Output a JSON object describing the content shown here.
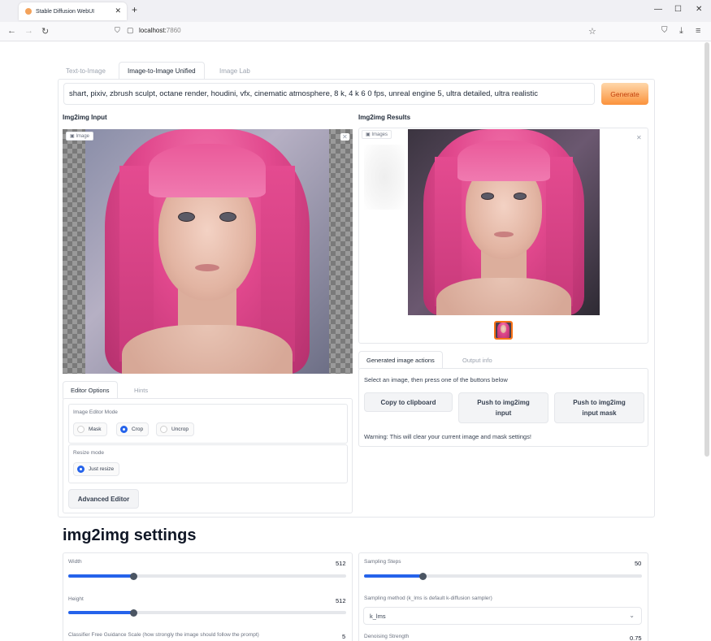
{
  "browser": {
    "tab_title": "Stable Diffusion WebUI",
    "url_host": "localhost:",
    "url_port": "7860"
  },
  "app": {
    "tabs": [
      "Text-to-Image",
      "Image-to-Image Unified",
      "Image Lab"
    ],
    "prompt": "shart, pixiv, zbrush sculpt, octane render, houdini, vfx, cinematic atmosphere, 8 k, 4 k 6 0 fps, unreal engine 5, ultra detailed, ultra realistic",
    "generate_label": "Generate"
  },
  "input": {
    "title": "Img2img Input",
    "image_tag": "Image",
    "tabs": [
      "Editor Options",
      "Hints"
    ],
    "editor_mode_label": "Image Editor Mode",
    "modes": [
      "Mask",
      "Crop",
      "Uncrop"
    ],
    "resize_label": "Resize mode",
    "resize_option": "Just resize",
    "advanced_editor": "Advanced Editor"
  },
  "results": {
    "title": "Img2img Results",
    "image_tag": "Images",
    "tabs": [
      "Generated image actions",
      "Output info"
    ],
    "instruction": "Select an image, then press one of the buttons below",
    "copy_btn": "Copy to clipboard",
    "push_btn": "Push to img2img input",
    "push_mask_btn": "Push to img2img input mask",
    "warning": "Warning: This will clear your current image and mask settings!"
  },
  "settings": {
    "title": "img2img settings",
    "width_label": "Width",
    "width_value": "512",
    "width_fraction": 0.27,
    "height_label": "Height",
    "height_value": "512",
    "height_fraction": 0.27,
    "cfg_label": "Classifier Free Guidance Scale (how strongly the image should follow the prompt)",
    "cfg_value": "5",
    "steps_label": "Sampling Steps",
    "steps_value": "50",
    "steps_fraction": 0.23,
    "sampler_label": "Sampling method (k_lms is default k-diffusion sampler)",
    "sampler_value": "k_lms",
    "denoise_label": "Denoising Strength",
    "denoise_value": "0.75"
  },
  "colors": {
    "accent": "#2563eb",
    "generate": "#fb923c",
    "hair": "#e1488d"
  }
}
